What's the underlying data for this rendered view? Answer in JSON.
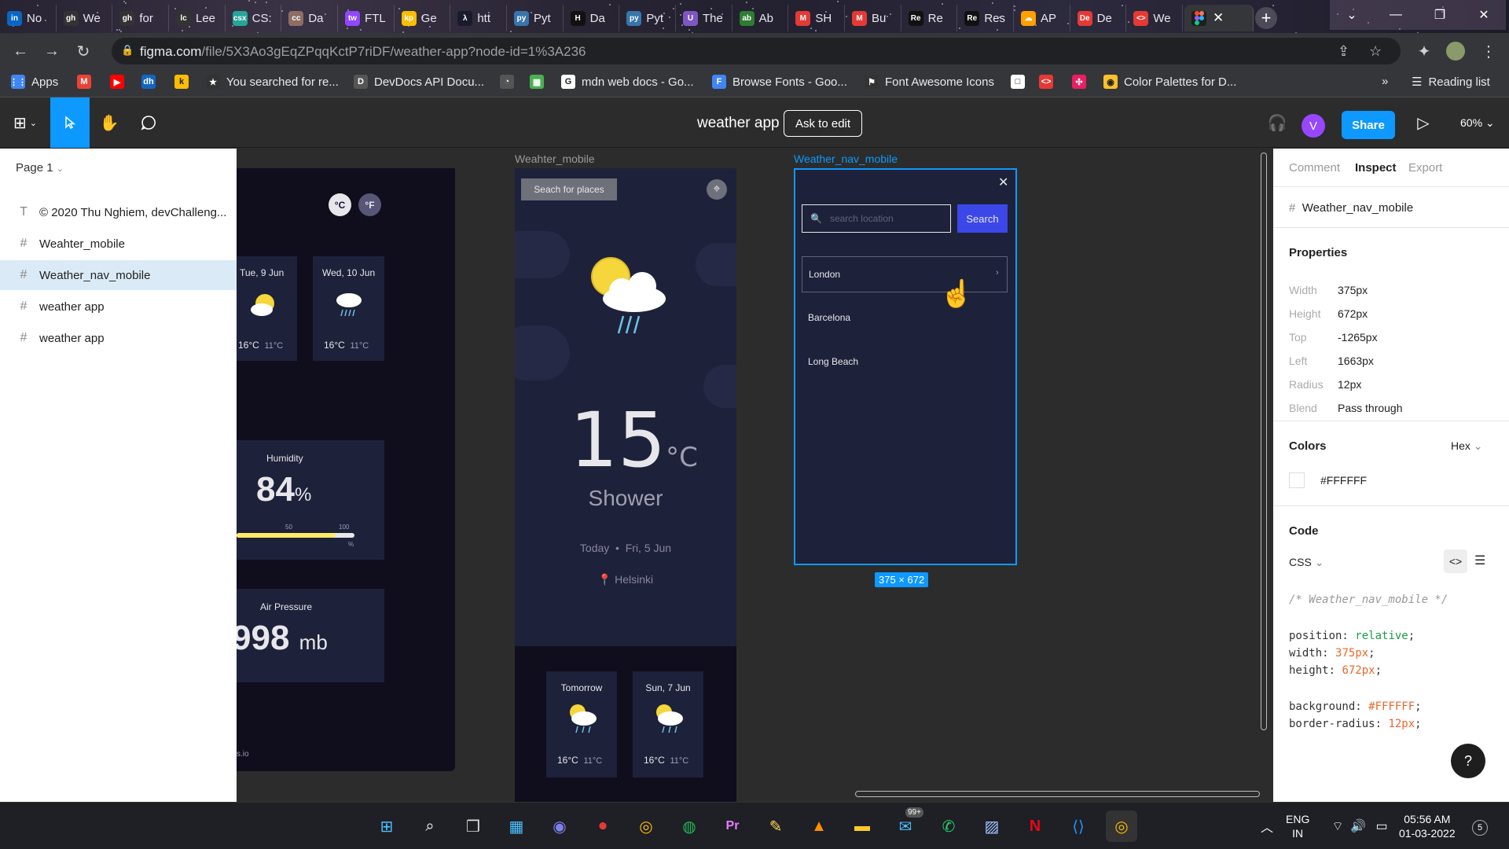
{
  "browser": {
    "tabs": [
      {
        "icon": "in",
        "label": "No",
        "color": "#0a66c2"
      },
      {
        "icon": "gh",
        "label": "We",
        "color": "#333"
      },
      {
        "icon": "gh",
        "label": "for",
        "color": "#333"
      },
      {
        "icon": "lc",
        "label": "Lee",
        "color": "#333"
      },
      {
        "icon": "csx",
        "label": "CS:",
        "color": "#26a69a"
      },
      {
        "icon": "cc",
        "label": "Da",
        "color": "#8d6e63"
      },
      {
        "icon": "tw",
        "label": "FTL",
        "color": "#9146ff"
      },
      {
        "icon": "kp",
        "label": "Ge",
        "color": "#fbbc04"
      },
      {
        "icon": "λ",
        "label": "htt",
        "color": "#1a1a2e"
      },
      {
        "icon": "py",
        "label": "Pyt",
        "color": "#3776ab"
      },
      {
        "icon": "H",
        "label": "Da",
        "color": "#111"
      },
      {
        "icon": "py",
        "label": "Pyt",
        "color": "#3776ab"
      },
      {
        "icon": "U",
        "label": "The",
        "color": "#7e57c2"
      },
      {
        "icon": "ab",
        "label": "Ab",
        "color": "#2e7d32"
      },
      {
        "icon": "M",
        "label": "SH",
        "color": "#e53935"
      },
      {
        "icon": "M",
        "label": "Bu",
        "color": "#e53935"
      },
      {
        "icon": "Re",
        "label": "Re",
        "color": "#111"
      },
      {
        "icon": "Re",
        "label": "Res",
        "color": "#111"
      },
      {
        "icon": "☁",
        "label": "AP",
        "color": "#ffa000"
      },
      {
        "icon": "De",
        "label": "De",
        "color": "#e53935"
      },
      {
        "icon": "<>",
        "label": "We",
        "color": "#e53935"
      }
    ],
    "url_host": "figma.com",
    "url_path": "/file/5X3Ao3gEqZPqqKctP7riDF/weather-app?node-id=1%3A236",
    "bookmarks": [
      {
        "label": "Apps",
        "color": "#4285f4",
        "icon": "apps"
      },
      {
        "label": "",
        "color": "#ea4335",
        "icon": "M"
      },
      {
        "label": "",
        "color": "#ff0000",
        "icon": "▶"
      },
      {
        "label": "",
        "color": "#1565c0",
        "icon": "dh"
      },
      {
        "label": "",
        "color": "#fbbc04",
        "icon": "k"
      },
      {
        "label": "You searched for re...",
        "color": "#333",
        "icon": "★"
      },
      {
        "label": "DevDocs API Docu...",
        "color": "#555",
        "icon": "D"
      },
      {
        "label": "",
        "color": "#555",
        "icon": "◔"
      },
      {
        "label": "",
        "color": "#4caf50",
        "icon": "▦"
      },
      {
        "label": "mdn web docs - Go...",
        "color": "#fff",
        "icon": "G"
      },
      {
        "label": "Browse Fonts - Goo...",
        "color": "#4285f4",
        "icon": "F"
      },
      {
        "label": "Font Awesome Icons",
        "color": "#333",
        "icon": "⚑"
      },
      {
        "label": "",
        "color": "#fff",
        "icon": "□"
      },
      {
        "label": "",
        "color": "#e53935",
        "icon": "<>"
      },
      {
        "label": "",
        "color": "#e91e63",
        "icon": "✣"
      },
      {
        "label": "Color Palettes for D...",
        "color": "#fbc02d",
        "icon": "◉"
      }
    ],
    "reading_list": "Reading list",
    "more": "»"
  },
  "figma": {
    "file_title": "weather app",
    "ask_edit": "Ask to edit",
    "avatar": "V",
    "share": "Share",
    "zoom": "60%",
    "page": "Page 1",
    "layers": [
      {
        "icon": "T",
        "label": "© 2020 Thu Nghiem, devChalleng..."
      },
      {
        "icon": "#",
        "label": "Weahter_mobile"
      },
      {
        "icon": "#",
        "label": "Weather_nav_mobile",
        "selected": true
      },
      {
        "icon": "#",
        "label": "weather app"
      },
      {
        "icon": "#",
        "label": "weather app"
      }
    ]
  },
  "canvas": {
    "left_frame": {
      "c": "°C",
      "f": "°F",
      "days": [
        {
          "label": "Tue, 9 Jun",
          "hi": "16°C",
          "lo": "11°C"
        },
        {
          "label": "Wed, 10 Jun",
          "hi": "16°C",
          "lo": "11°C"
        }
      ],
      "humidity_title": "Humidity",
      "humidity_value": "84",
      "humidity_unit": "%",
      "humidity_percent": 84,
      "scale": [
        "50",
        "100"
      ],
      "scale_unit": "%",
      "pressure_title": "Air Pressure",
      "pressure_value": "998",
      "pressure_unit": "mb",
      "footer": "s.io"
    },
    "mobile_frame": {
      "label": "Weahter_mobile",
      "search": "Seach for places",
      "temp": "15",
      "temp_unit": "°C",
      "condition": "Shower",
      "today": "Today",
      "dot": "•",
      "date": "Fri, 5 Jun",
      "location": "Helsinki",
      "days": [
        {
          "label": "Tomorrow",
          "hi": "16°C",
          "lo": "11°C"
        },
        {
          "label": "Sun, 7 Jun",
          "hi": "16°C",
          "lo": "11°C"
        }
      ]
    },
    "nav_frame": {
      "label": "Weather_nav_mobile",
      "placeholder": "search location",
      "search_btn": "Search",
      "cities": [
        "London",
        "Barcelona",
        "Long Beach"
      ],
      "size": "375 × 672"
    }
  },
  "inspect": {
    "tabs": [
      "Comment",
      "Inspect",
      "Export"
    ],
    "active_tab": "Inspect",
    "node": "Weather_nav_mobile",
    "properties_title": "Properties",
    "properties": [
      {
        "k": "Width",
        "v": "375px"
      },
      {
        "k": "Height",
        "v": "672px"
      },
      {
        "k": "Top",
        "v": "-1265px"
      },
      {
        "k": "Left",
        "v": "1663px"
      },
      {
        "k": "Radius",
        "v": "12px"
      },
      {
        "k": "Blend",
        "v": "Pass through"
      }
    ],
    "colors_title": "Colors",
    "color_format": "Hex",
    "color_value": "#FFFFFF",
    "code_title": "Code",
    "code_lang": "CSS",
    "code_comment": "/* Weather_nav_mobile */",
    "code_lines": [
      {
        "prop": "position",
        "val": "relative",
        "type": "kw"
      },
      {
        "prop": "width",
        "val": "375px",
        "type": "num"
      },
      {
        "prop": "height",
        "val": "672px",
        "type": "num"
      },
      {
        "prop": "background",
        "val": "#FFFFFF",
        "type": "num"
      },
      {
        "prop": "border-radius",
        "val": "12px",
        "type": "num"
      }
    ],
    "help": "?"
  },
  "taskbar": {
    "lang1": "ENG",
    "lang2": "IN",
    "time": "05:56 AM",
    "date": "01-03-2022",
    "badge": "99+",
    "notif": "5"
  }
}
